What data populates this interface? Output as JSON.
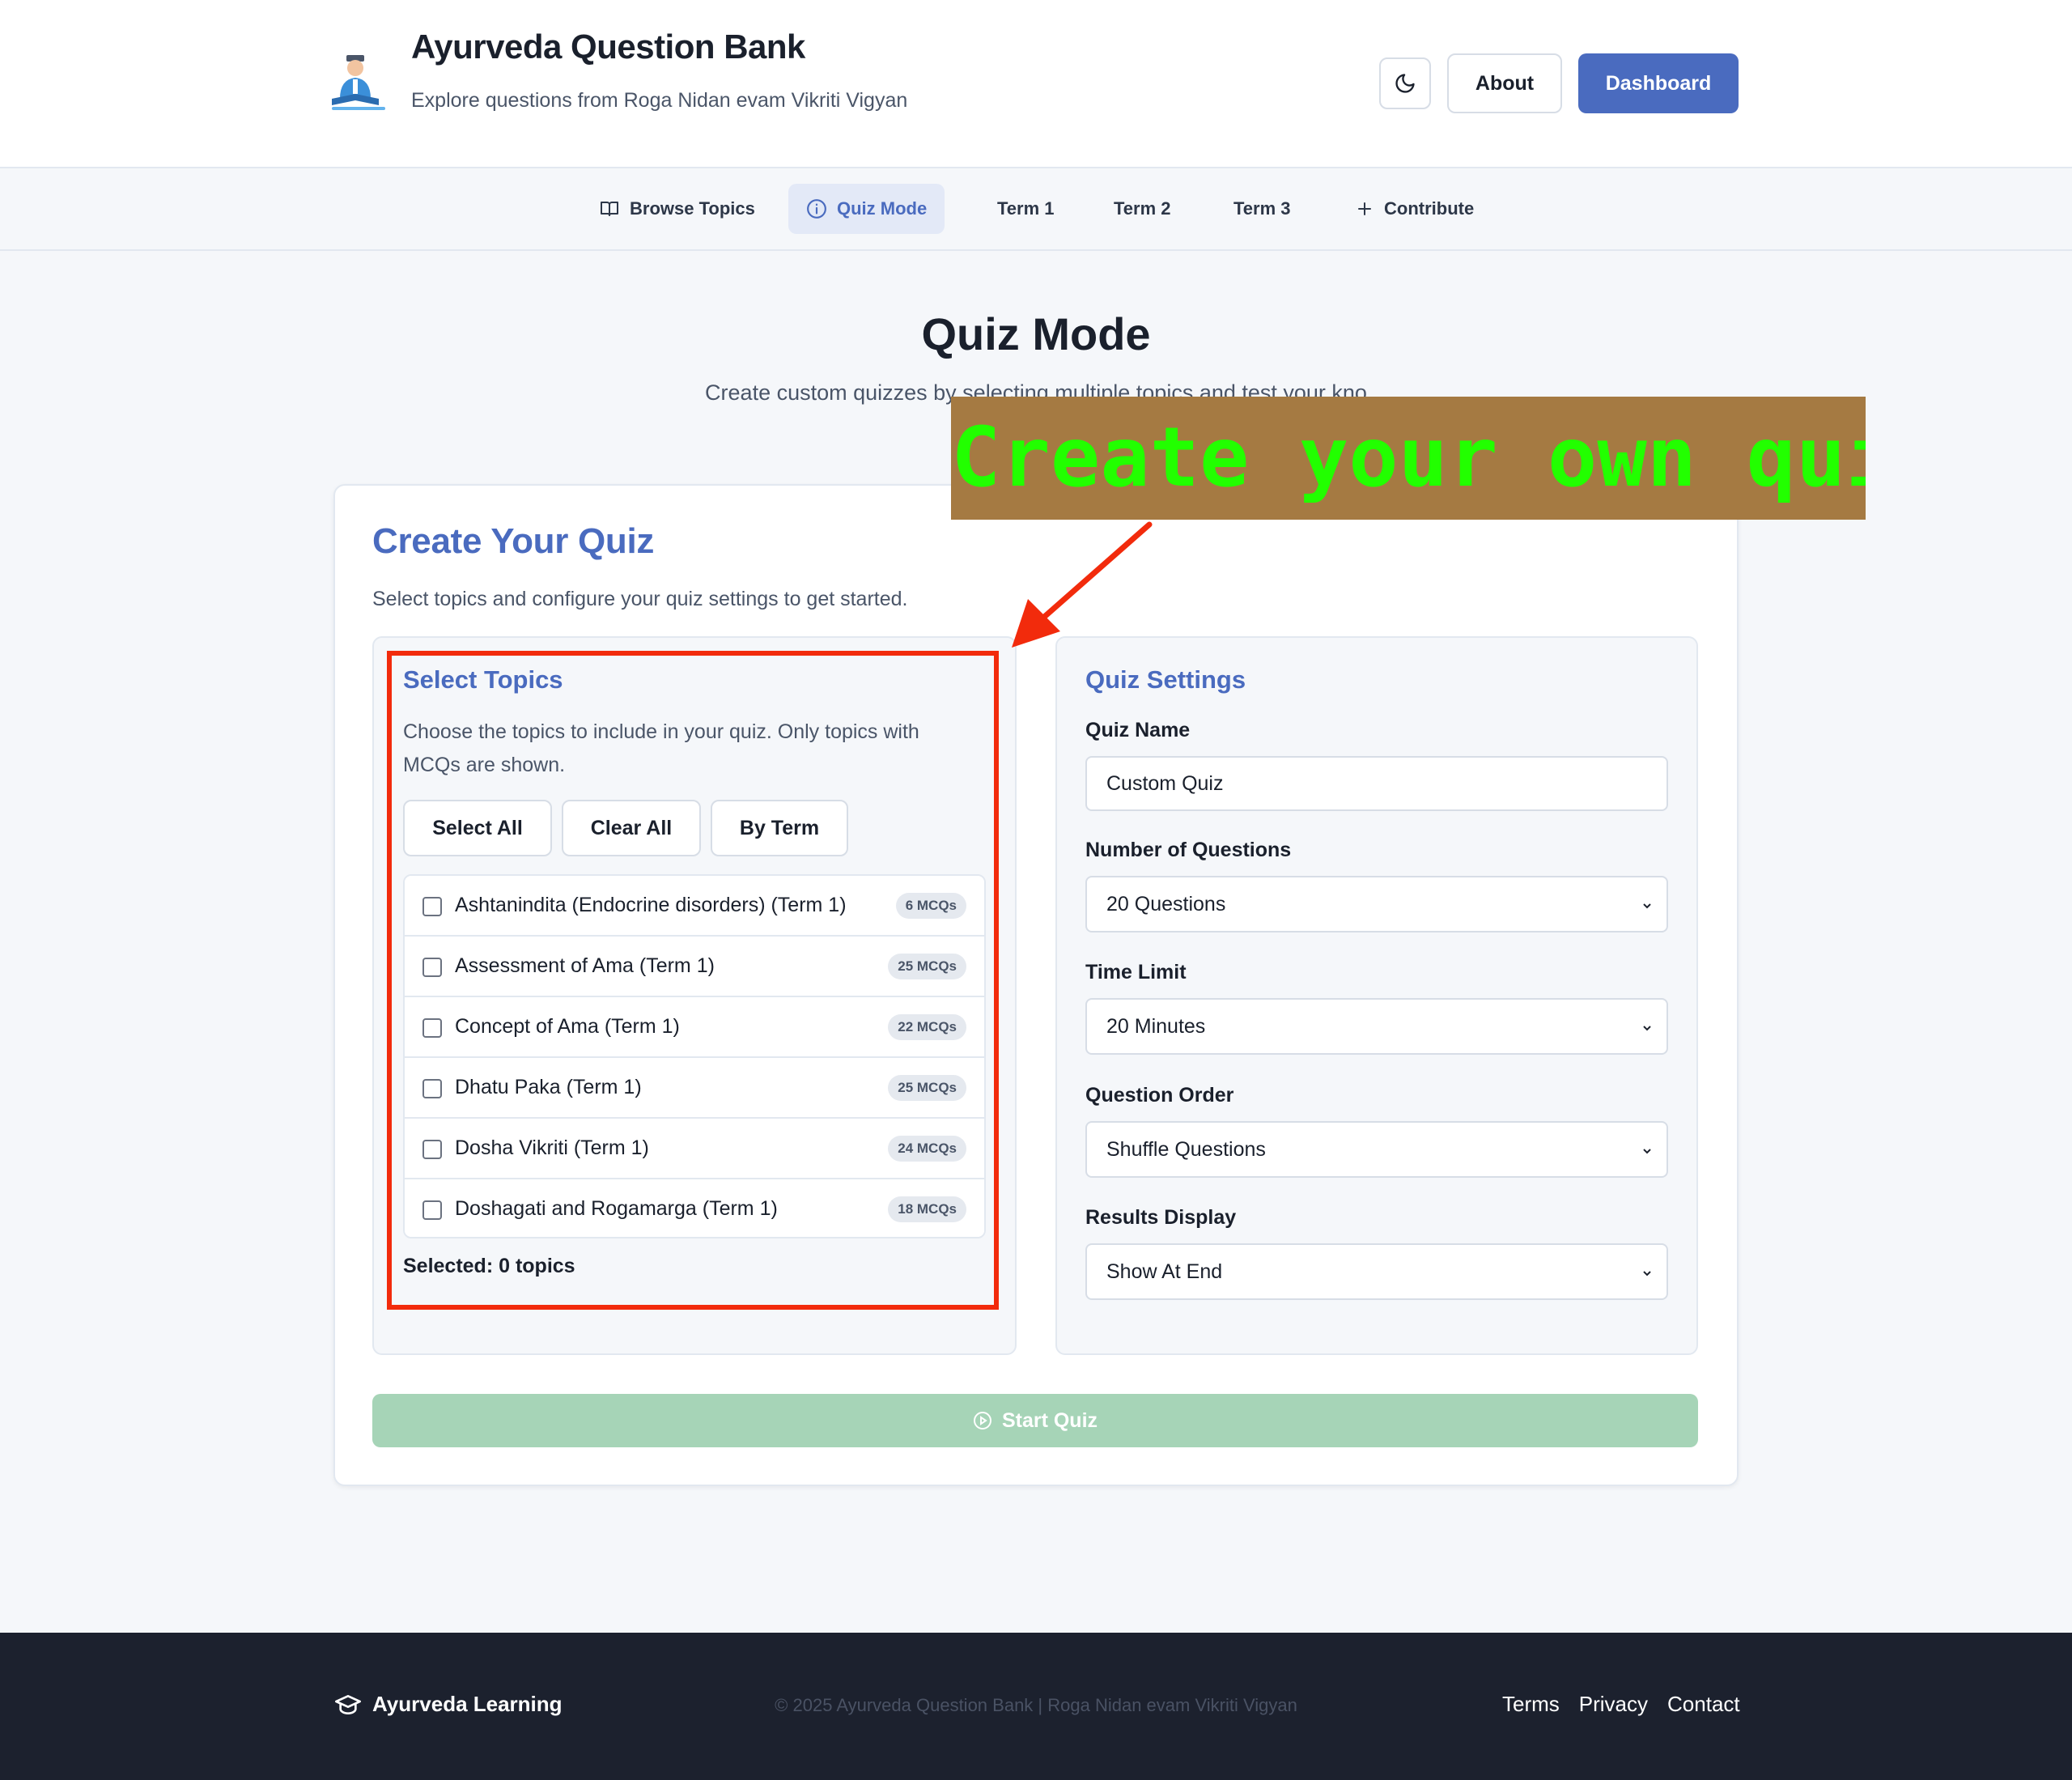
{
  "header": {
    "title": "Ayurveda Question Bank",
    "subtitle": "Explore questions from Roga Nidan evam Vikriti Vigyan",
    "about_label": "About",
    "dashboard_label": "Dashboard"
  },
  "nav": {
    "items": [
      {
        "label": "Browse Topics",
        "icon": "book-icon"
      },
      {
        "label": "Quiz Mode",
        "icon": "info-circle-icon",
        "active": true
      },
      {
        "label": "Term 1"
      },
      {
        "label": "Term 2"
      },
      {
        "label": "Term 3"
      },
      {
        "label": "Contribute",
        "icon": "plus-icon"
      }
    ]
  },
  "main": {
    "title": "Quiz Mode",
    "description": "Create custom quizzes by selecting multiple topics and test your kno"
  },
  "card": {
    "title": "Create Your Quiz",
    "description": "Select topics and configure your quiz settings to get started."
  },
  "topics": {
    "title": "Select Topics",
    "description": "Choose the topics to include in your quiz. Only topics with MCQs are shown.",
    "buttons": [
      "Select All",
      "Clear All",
      "By Term"
    ],
    "items": [
      {
        "label": "Ashtanindita (Endocrine disorders) (Term 1)",
        "badge": "6 MCQs"
      },
      {
        "label": "Assessment of Ama (Term 1)",
        "badge": "25 MCQs"
      },
      {
        "label": "Concept of Ama (Term 1)",
        "badge": "22 MCQs"
      },
      {
        "label": "Dhatu Paka (Term 1)",
        "badge": "25 MCQs"
      },
      {
        "label": "Dosha Vikriti (Term 1)",
        "badge": "24 MCQs"
      },
      {
        "label": "Doshagati and Rogamarga (Term 1)",
        "badge": "18 MCQs"
      }
    ],
    "selected_text": "Selected: 0 topics"
  },
  "settings": {
    "title": "Quiz Settings",
    "quiz_name_label": "Quiz Name",
    "quiz_name_value": "Custom Quiz",
    "num_questions_label": "Number of Questions",
    "num_questions_value": "20 Questions",
    "time_limit_label": "Time Limit",
    "time_limit_value": "20 Minutes",
    "order_label": "Question Order",
    "order_value": "Shuffle Questions",
    "results_label": "Results Display",
    "results_value": "Show At End"
  },
  "start_label": "Start Quiz",
  "annotation": {
    "callout": "Create your own quiz",
    "callout_bg": "#a57a42",
    "callout_text_color": "#22ff00",
    "highlight_color": "#f22b0c"
  },
  "footer": {
    "brand": "Ayurveda Learning",
    "copyright": "© 2025 Ayurveda Question Bank | Roga Nidan evam Vikriti Vigyan",
    "links": [
      "Terms",
      "Privacy",
      "Contact"
    ]
  },
  "colors": {
    "accent": "#4a6bbf",
    "start_button": "#a6d4b7",
    "footer_bg": "#1c212e"
  }
}
